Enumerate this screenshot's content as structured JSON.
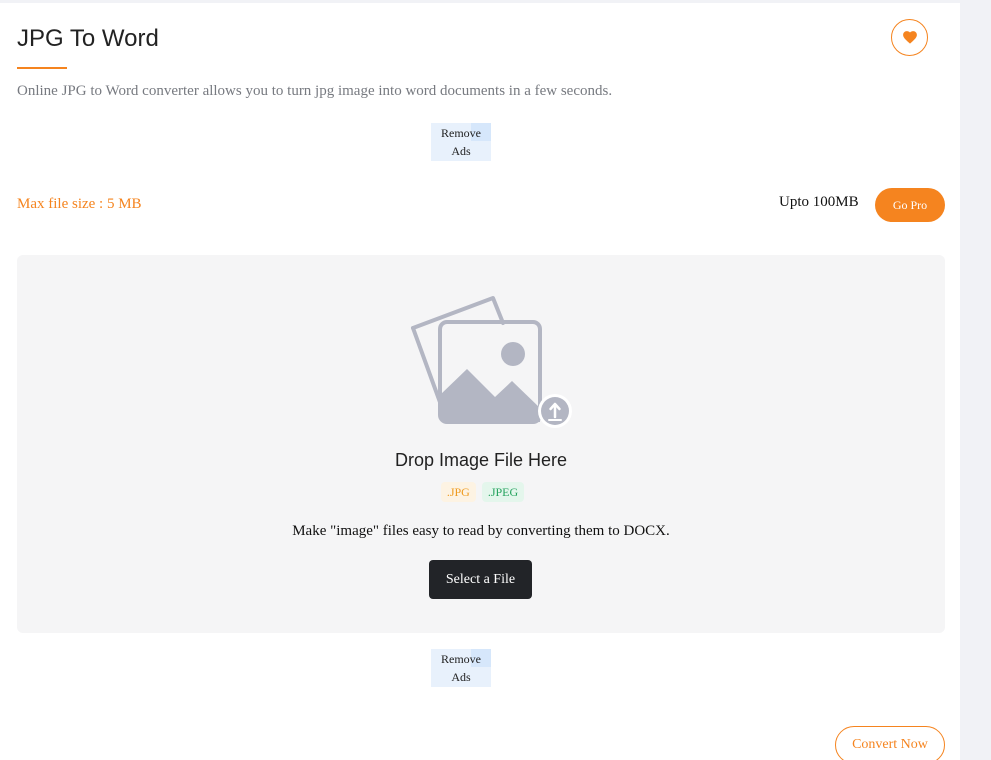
{
  "header": {
    "title": "JPG To Word",
    "description": "Online JPG to Word converter allows you to turn jpg image into word documents in a few seconds.",
    "favorite_icon": "heart-icon"
  },
  "ads": {
    "remove_line1": "Remove",
    "remove_line2": "Ads"
  },
  "limits": {
    "max_file_size": "Max file size : 5 MB",
    "pro_limit": "Upto 100MB",
    "go_pro_label": "Go Pro"
  },
  "dropzone": {
    "illustration_icon": "image-upload-icon",
    "title": "Drop Image File Here",
    "formats": [
      ".JPG",
      ".JPEG"
    ],
    "subtitle": "Make \"image\" files easy to read by converting them to DOCX.",
    "select_label": "Select a File"
  },
  "footer": {
    "convert_label": "Convert Now"
  },
  "colors": {
    "accent": "#f5841f",
    "dark_button": "#222428",
    "jpg_badge": "#ef9a1d",
    "jpeg_badge": "#25a35e"
  }
}
